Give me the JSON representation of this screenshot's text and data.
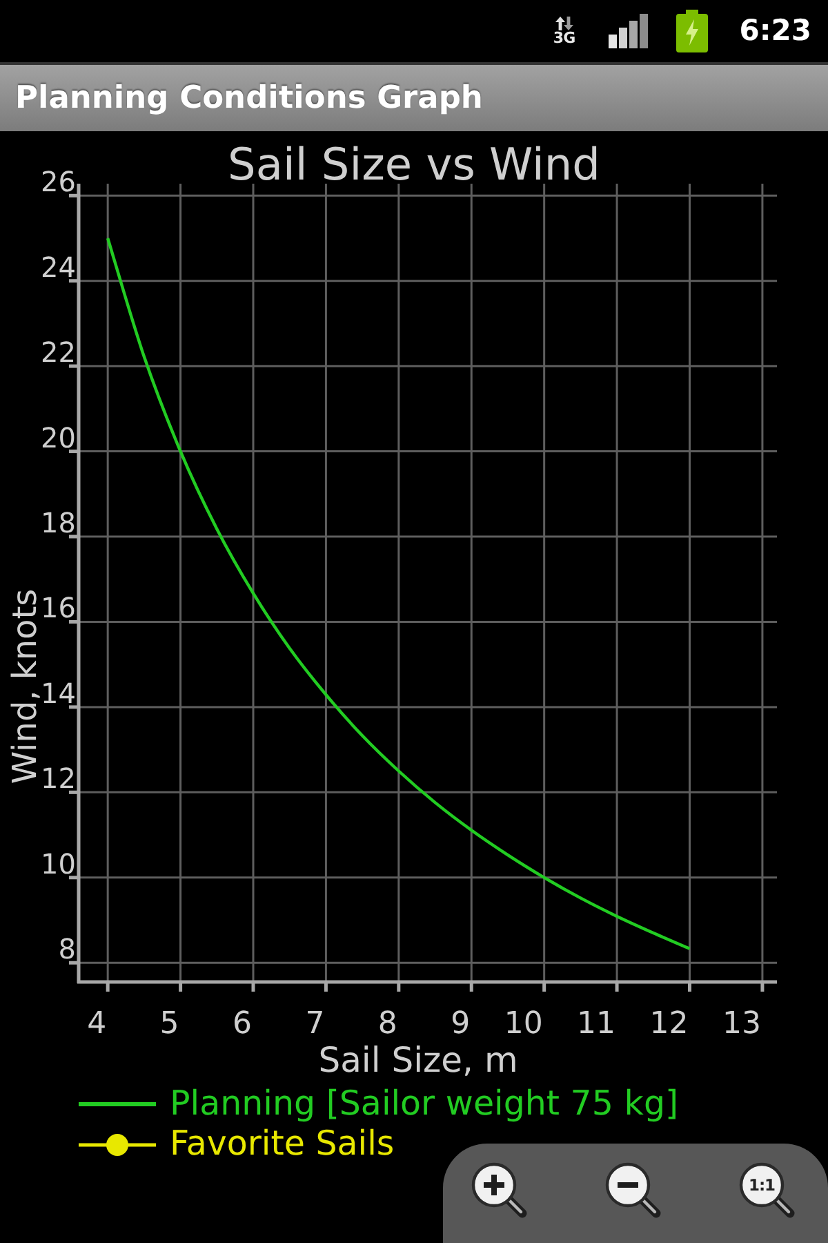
{
  "status_bar": {
    "network_type": "3G",
    "time": "6:23"
  },
  "title_bar": {
    "title": "Planning Conditions Graph"
  },
  "graph": {
    "chart_data": {
      "type": "line",
      "title": "Sail Size vs Wind",
      "xlabel": "Sail Size, m",
      "ylabel": "Wind, knots",
      "x": [
        4,
        4.5,
        5,
        5.5,
        6,
        6.5,
        7,
        7.5,
        8,
        8.5,
        9,
        9.5,
        10,
        10.5,
        11,
        11.5,
        12
      ],
      "series": [
        {
          "name": "Planning [Sailor weight 75 kg]",
          "color": "#22cc22",
          "values": [
            25,
            22.22,
            20,
            18.18,
            16.67,
            15.38,
            14.29,
            13.33,
            12.5,
            11.76,
            11.11,
            10.53,
            10,
            9.52,
            9.09,
            8.7,
            8.33
          ]
        },
        {
          "name": "Favorite Sails",
          "color": "#e8e800",
          "marker": "circle",
          "values": [
            null,
            null,
            null,
            null,
            null,
            null,
            null,
            null,
            null,
            null,
            null,
            null,
            null,
            null,
            null,
            null,
            null
          ]
        }
      ],
      "xlim": [
        3.6,
        13.2
      ],
      "ylim": [
        7.55,
        26.28
      ],
      "xticks": [
        4,
        5,
        6,
        7,
        8,
        9,
        10,
        11,
        12,
        13
      ],
      "yticks": [
        8,
        10,
        12,
        14,
        16,
        18,
        20,
        22,
        24,
        26
      ],
      "grid": true
    }
  },
  "zoom_controls": [
    {
      "kind": "zoom-in"
    },
    {
      "kind": "zoom-out"
    },
    {
      "kind": "actual-size",
      "label": "1:1"
    }
  ]
}
